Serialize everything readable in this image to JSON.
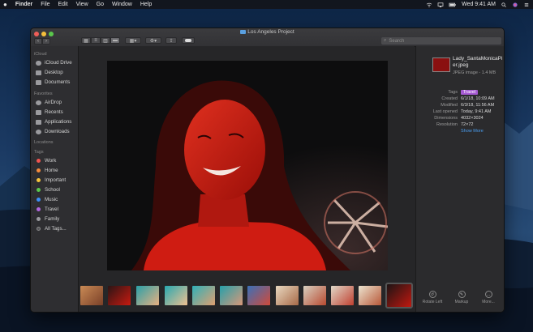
{
  "menubar": {
    "apple": "",
    "app": "Finder",
    "menus": [
      "File",
      "Edit",
      "View",
      "Go",
      "Window",
      "Help"
    ],
    "datetime": "Wed 9:41 AM"
  },
  "window": {
    "title": "Los Angeles Project",
    "search_placeholder": "Search"
  },
  "sidebar": {
    "icloud_title": "iCloud",
    "icloud": [
      "iCloud Drive",
      "Desktop",
      "Documents"
    ],
    "favorites_title": "Favorites",
    "favorites": [
      "AirDrop",
      "Recents",
      "Applications",
      "Downloads"
    ],
    "locations_title": "Locations",
    "tags_title": "Tags",
    "tags": [
      {
        "label": "Work",
        "color": "#f0544f"
      },
      {
        "label": "Home",
        "color": "#f58a3c"
      },
      {
        "label": "Important",
        "color": "#f5c33c"
      },
      {
        "label": "School",
        "color": "#5ac74c"
      },
      {
        "label": "Music",
        "color": "#3c8ef5"
      },
      {
        "label": "Travel",
        "color": "#b066dd"
      },
      {
        "label": "Family",
        "color": "#9a9a9e"
      },
      {
        "label": "All Tags...",
        "color": "#555558"
      }
    ]
  },
  "inspector": {
    "filename": "Lady_SantaMonicaPier.jpeg",
    "filetype": "JPEG image - 1.4 MB",
    "tags_label": "Tags",
    "tag_value": "Travel",
    "created_label": "Created",
    "created": "6/1/18, 10:09 AM",
    "modified_label": "Modified",
    "modified": "6/3/18, 11:56 AM",
    "opened_label": "Last opened",
    "opened": "Today, 9:41 AM",
    "dimensions_label": "Dimensions",
    "dimensions": "4032×3024",
    "resolution_label": "Resolution",
    "resolution": "72×72",
    "show_more": "Show More",
    "actions": [
      "Rotate Left",
      "Markup",
      "More..."
    ]
  },
  "colors": {
    "accent": "#4a9ef0",
    "tag_pill": "#a65bd3",
    "photo_red": "#d01a10"
  }
}
